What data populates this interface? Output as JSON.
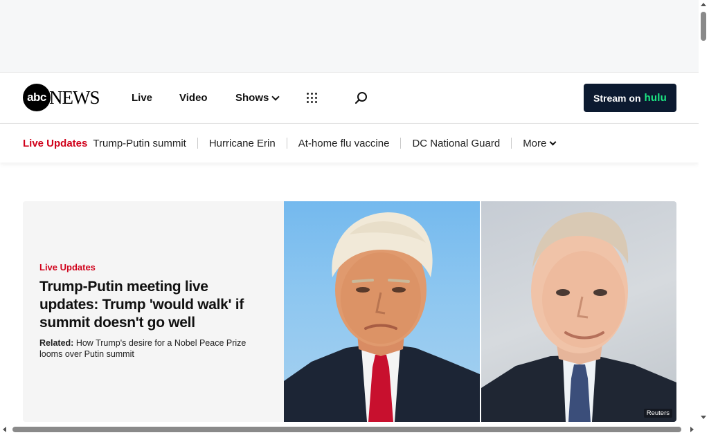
{
  "header": {
    "logo_badge": "abc",
    "logo_text": "NEWS",
    "nav": {
      "live": "Live",
      "video": "Video",
      "shows": "Shows"
    },
    "stream_prefix": "Stream on",
    "stream_brand": "hulu"
  },
  "trending": {
    "label": "Live Updates",
    "items": [
      "Trump-Putin summit",
      "Hurricane Erin",
      "At-home flu vaccine",
      "DC National Guard"
    ],
    "more": "More"
  },
  "hero": {
    "kicker": "Live Updates",
    "headline": "Trump-Putin meeting live updates: Trump 'would walk' if summit doesn't go well",
    "related_label": "Related:",
    "related_text": "How Trump's desire for a Nobel Peace Prize looms over Putin summit",
    "image_credit": "Reuters"
  },
  "colors": {
    "accent_red": "#d0021b",
    "hulu_green": "#1ce783",
    "stream_bg": "#0c1a30"
  }
}
